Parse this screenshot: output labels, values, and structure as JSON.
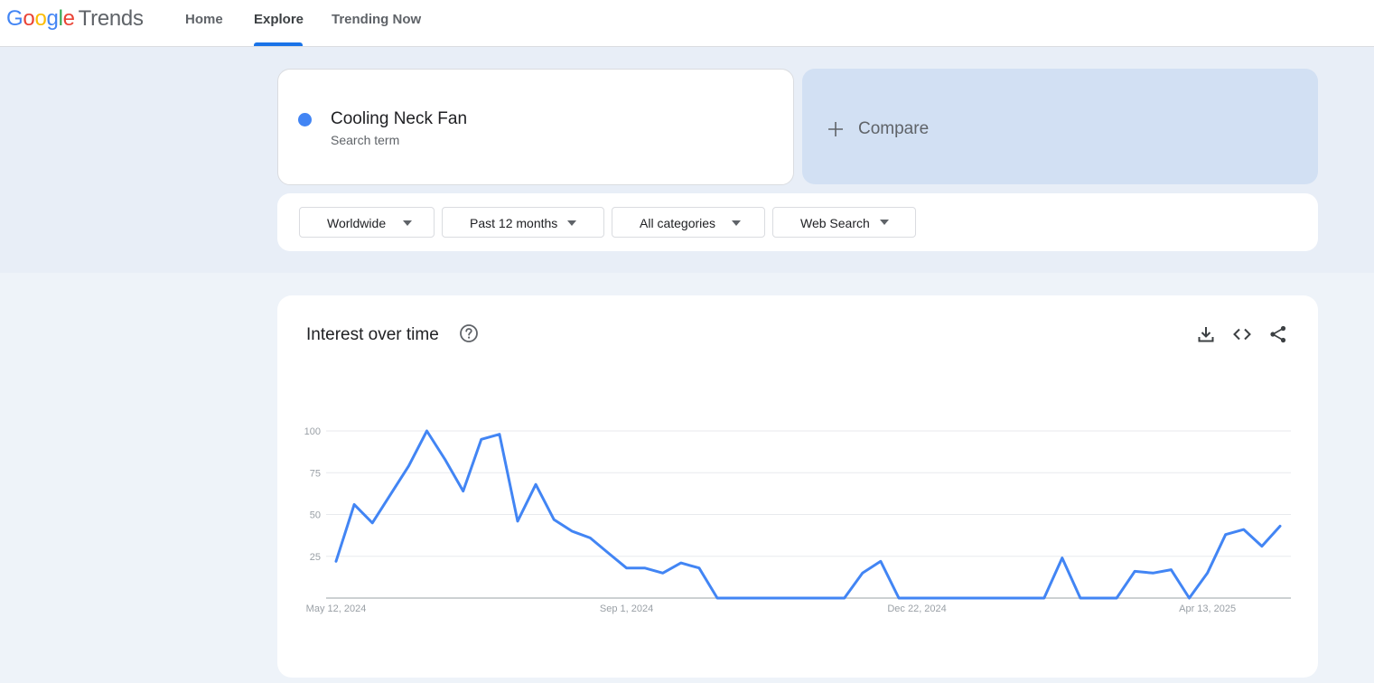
{
  "header": {
    "logo": {
      "letters": [
        "G",
        "o",
        "o",
        "g",
        "l",
        "e"
      ],
      "colors": [
        "#4285f4",
        "#ea4335",
        "#fbbc05",
        "#4285f4",
        "#34a853",
        "#ea4335"
      ],
      "product": "Trends"
    },
    "nav": [
      {
        "label": "Home",
        "active": false
      },
      {
        "label": "Explore",
        "active": true
      },
      {
        "label": "Trending Now",
        "active": false
      }
    ]
  },
  "search": {
    "term": "Cooling Neck Fan",
    "term_type": "Search term",
    "term_color": "#4285f4",
    "compare_label": "Compare",
    "compare_icon": "plus-icon"
  },
  "filters": [
    {
      "label": "Worldwide"
    },
    {
      "label": "Past 12 months"
    },
    {
      "label": "All categories"
    },
    {
      "label": "Web Search"
    }
  ],
  "chart_panel": {
    "title": "Interest over time",
    "icons": [
      "help-icon",
      "download-icon",
      "embed-icon",
      "share-icon"
    ]
  },
  "chart_data": {
    "type": "line",
    "title": "Interest over time",
    "xlabel": "",
    "ylabel": "",
    "ylim": [
      0,
      100
    ],
    "yticks": [
      25,
      50,
      75,
      100
    ],
    "xtick_labels": [
      "May 12, 2024",
      "Sep 1, 2024",
      "Dec 22, 2024",
      "Apr 13, 2025"
    ],
    "xtick_indices": [
      0,
      16,
      32,
      48
    ],
    "grid": true,
    "series": [
      {
        "color": "#4285f4",
        "values": [
          22,
          56,
          45,
          62,
          79,
          100,
          83,
          64,
          95,
          98,
          46,
          68,
          47,
          40,
          36,
          27,
          18,
          18,
          15,
          21,
          18,
          0,
          0,
          0,
          0,
          0,
          0,
          0,
          0,
          15,
          22,
          0,
          0,
          0,
          0,
          0,
          0,
          0,
          0,
          0,
          24,
          0,
          0,
          0,
          16,
          15,
          17,
          0,
          15,
          38,
          41,
          31,
          43
        ]
      }
    ]
  }
}
